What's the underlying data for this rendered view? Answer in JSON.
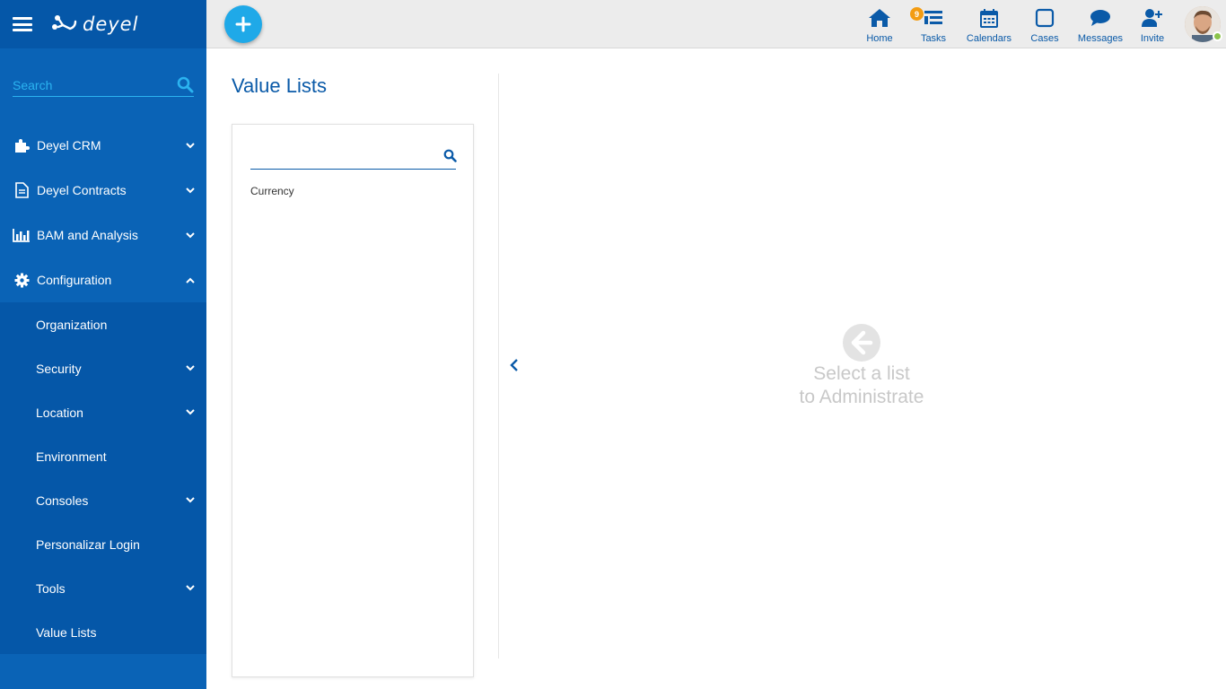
{
  "app": {
    "logo_text": "deyel"
  },
  "search": {
    "placeholder": "Search"
  },
  "sidebar": {
    "items": [
      {
        "label": "Deyel CRM",
        "icon": "puzzle-icon"
      },
      {
        "label": "Deyel Contracts",
        "icon": "document-icon"
      },
      {
        "label": "BAM and Analysis",
        "icon": "bar-chart-icon"
      },
      {
        "label": "Configuration",
        "icon": "gear-icon"
      }
    ],
    "sub_items": [
      {
        "label": "Organization"
      },
      {
        "label": "Security"
      },
      {
        "label": "Location"
      },
      {
        "label": "Environment"
      },
      {
        "label": "Consoles"
      },
      {
        "label": "Personalizar Login"
      },
      {
        "label": "Tools"
      },
      {
        "label": "Value Lists"
      }
    ]
  },
  "topbar": {
    "home": "Home",
    "tasks": "Tasks",
    "tasks_badge": "9",
    "calendars": "Calendars",
    "cases": "Cases",
    "messages": "Messages",
    "invite": "Invite"
  },
  "main": {
    "title": "Value Lists",
    "list": {
      "search_placeholder": "",
      "items": [
        "Currency"
      ]
    },
    "empty_line1": "Select a list",
    "empty_line2": "to Administrate"
  },
  "colors": {
    "sidebar": "#0a63b6",
    "accent": "#1fa9e8",
    "link": "#0a5aa8",
    "badge": "#f39c12",
    "presence": "#8bc34a"
  }
}
